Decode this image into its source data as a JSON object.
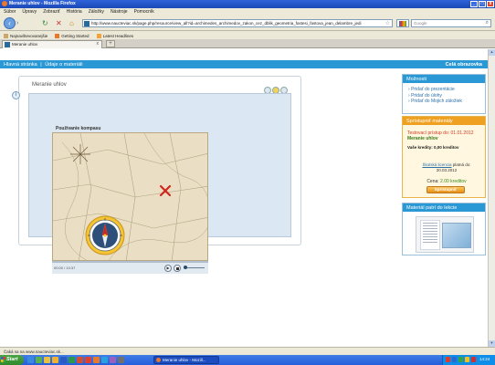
{
  "window": {
    "title": "Meranie uhlov - Mozilla Firefox",
    "minimize": "_",
    "maximize": "□",
    "close": "x"
  },
  "menu": [
    "Súbor",
    "Úpravy",
    "Zobraziť",
    "História",
    "Záložky",
    "Nástroje",
    "Pomocník"
  ],
  "nav": {
    "url": "http://www.naucteviac.sk/page.php/resource/view_all?id=archimedes_archimedov_zakon_cez_dblik_geometria_fastesi_fastova_jean_delambre_jedi",
    "search_placeholder": "Google"
  },
  "bookmarks": [
    {
      "label": "Najnavštevovanejšie",
      "color": "#c9a86a"
    },
    {
      "label": "Getting Started",
      "color": "#e8792a"
    },
    {
      "label": "Latest Headlines",
      "color": "#f2a33a"
    }
  ],
  "tab": {
    "label": "Meranie uhlov",
    "close": "x",
    "new": "+"
  },
  "site": {
    "crumbs": [
      "Hlavná stránka",
      "Údaje o materiáli"
    ],
    "crumb_sep": "|",
    "right_label": "Celá obrazovka"
  },
  "content": {
    "lesson_title": "Meranie uhlov",
    "info_icon_label": "i",
    "video_title": "Používanie kompasu",
    "time": "00:00 / 10:37",
    "progress": 0,
    "play_label": "▶"
  },
  "options": {
    "header": "Možnosti",
    "items": [
      "Pridať do prezentácie",
      "Pridať do úlohy",
      "Pridať do Mojich záložiek"
    ]
  },
  "shop": {
    "header": "Sprístupniť materiály",
    "trial_line1": "Testovací prístup do: 01.01.2012",
    "trial_line2": "Meranie uhlov",
    "credits": "Vaše kredity: 0,00 kreditov",
    "license_link": "Školská licencia",
    "license_rest": " platná do:",
    "license_date": "20.03.2012",
    "price_label": "Cena: ",
    "price_value": "2.00 kreditov",
    "buy_button": "Sprístupniť"
  },
  "belongs": {
    "header": "Materiál patrí do lekcie"
  },
  "statusbar": "Čaká sa na www.naucteviac.sk...",
  "taskbar": {
    "start": "Start",
    "task_label": "Meranie uhlov - Mozill...",
    "clock": "14:24"
  },
  "colors": {
    "accent": "#2a98d4",
    "shop_header": "#f0a020",
    "taskbar": "#245edb"
  }
}
